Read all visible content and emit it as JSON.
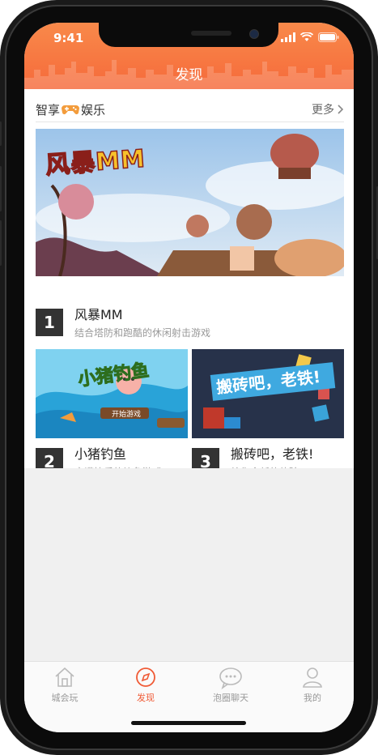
{
  "status_bar": {
    "time": "9:41"
  },
  "header": {
    "title": "发现"
  },
  "section": {
    "title_part1": "智享",
    "title_part2": "娱乐",
    "more_label": "更多"
  },
  "games": [
    {
      "rank": "1",
      "name": "风暴MM",
      "desc": "结合塔防和跑酷的休闲射击游戏",
      "banner_text": "风暴MM"
    },
    {
      "rank": "2",
      "name": "小猪钓鱼",
      "desc": "充满快乐的钓鱼游戏",
      "banner_text": "小猪钓鱼",
      "banner_sub": "开始游戏"
    },
    {
      "rank": "3",
      "name": "搬砖吧，老铁!",
      "desc": "给你全新的体验",
      "banner_text": "搬砖吧，老铁!"
    }
  ],
  "tabbar": [
    {
      "label": "城会玩",
      "icon": "home-icon",
      "active": false
    },
    {
      "label": "发现",
      "icon": "compass-icon",
      "active": true
    },
    {
      "label": "泡圈聊天",
      "icon": "chat-icon",
      "active": false
    },
    {
      "label": "我的",
      "icon": "user-icon",
      "active": false
    }
  ],
  "colors": {
    "accent": "#f05a35",
    "header": "#f66a3b",
    "inactive": "#999999"
  }
}
